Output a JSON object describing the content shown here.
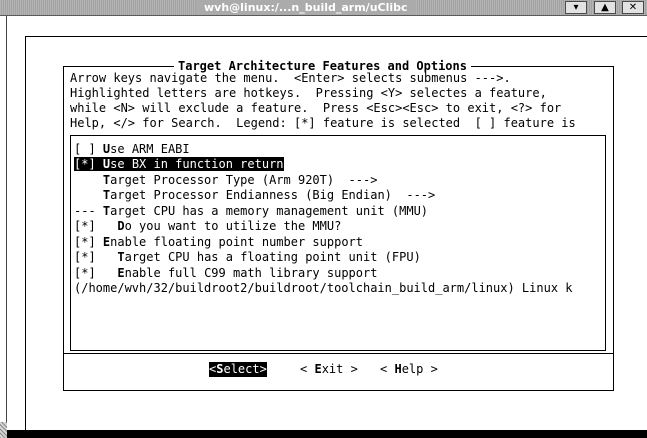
{
  "window": {
    "title": "wvh@linux:/...n_build_arm/uClibc",
    "buttons": [
      "▾",
      "▲",
      "✕"
    ]
  },
  "dialog": {
    "title": "Target Architecture Features and Options",
    "help_lines": [
      "Arrow keys navigate the menu.  <Enter> selects submenus --->.",
      "Highlighted letters are hotkeys.  Pressing <Y> selectes a feature,",
      "while <N> will exclude a feature.  Press <Esc><Esc> to exit, <?> for",
      "Help, </> for Search.  Legend: [*] feature is selected  [ ] feature is"
    ],
    "items": [
      {
        "prefix": "[ ] ",
        "hotkey": "U",
        "text": "se ARM EABI",
        "selected": false
      },
      {
        "prefix": "[*] ",
        "hotkey": "U",
        "text": "se BX in function return",
        "selected": true
      },
      {
        "prefix": "    ",
        "hotkey": "T",
        "text": "arget Processor Type (Arm 920T)  --->",
        "selected": false
      },
      {
        "prefix": "    ",
        "hotkey": "T",
        "text": "arget Processor Endianness (Big Endian)  --->",
        "selected": false
      },
      {
        "prefix": "--- ",
        "hotkey": "T",
        "text": "arget CPU has a memory management unit (MMU)",
        "selected": false
      },
      {
        "prefix": "[*]   ",
        "hotkey": "D",
        "text": "o you want to utilize the MMU?",
        "selected": false
      },
      {
        "prefix": "[*] ",
        "hotkey": "E",
        "text": "nable floating point number support",
        "selected": false
      },
      {
        "prefix": "[*]   ",
        "hotkey": "T",
        "text": "arget CPU has a floating point unit (FPU)",
        "selected": false
      },
      {
        "prefix": "[*]   ",
        "hotkey": "E",
        "text": "nable full C99 math library support",
        "selected": false
      },
      {
        "prefix": "",
        "hotkey": "",
        "text": "(/home/wvh/32/buildroot2/buildroot/toolchain_build_arm/linux) Linux k",
        "selected": false
      }
    ],
    "buttons": [
      {
        "pre": "<",
        "hotkey": "S",
        "post": "elect>",
        "active": true
      },
      {
        "pre": "< ",
        "hotkey": "E",
        "post": "xit >",
        "active": false
      },
      {
        "pre": "< ",
        "hotkey": "H",
        "post": "elp >",
        "active": false
      }
    ]
  }
}
